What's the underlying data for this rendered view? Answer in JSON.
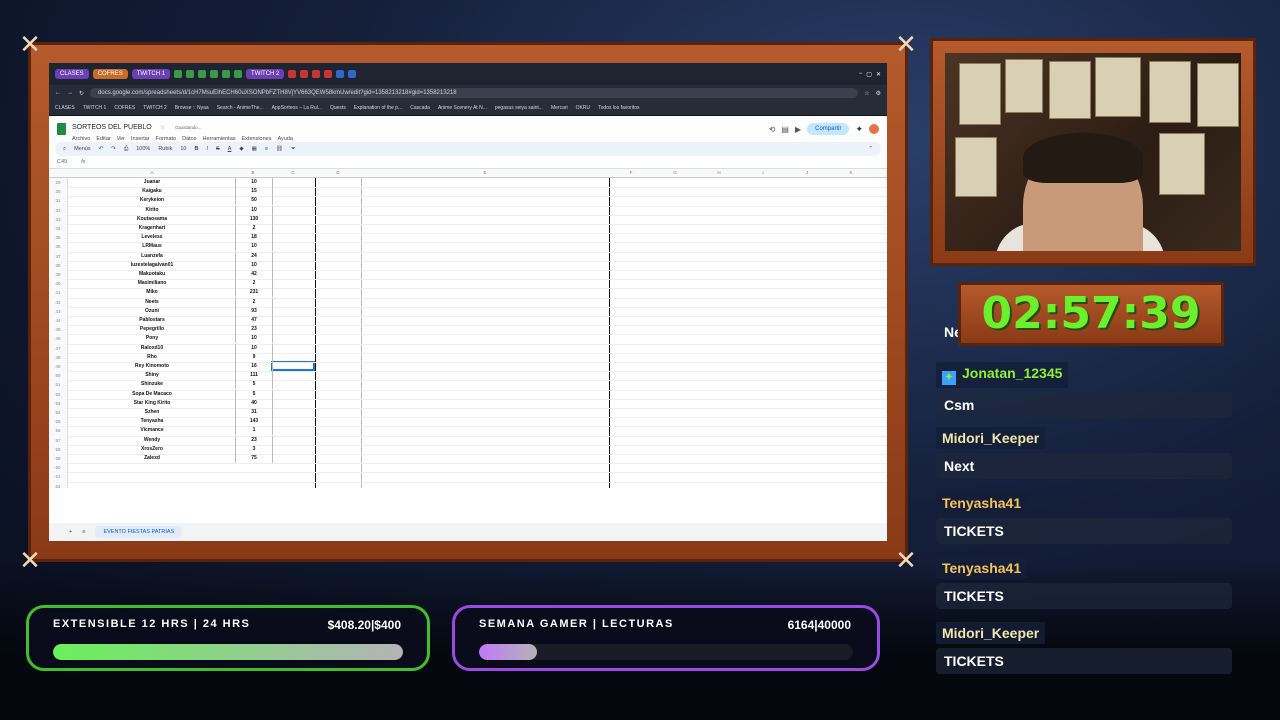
{
  "browser": {
    "tabs": [
      "CLASES",
      "COFRES",
      "TWITCH 1",
      "TWITCH 2"
    ],
    "url": "docs.google.com/spreadsheets/d/1cH7MsuEIhECH60uXSONPbFZTH8VjYV663QEW58kmUw/edit?gid=1358213218#gid=1358213218",
    "bookmarks": [
      "CLASES",
      "TWITCH 1",
      "COFRES",
      "TWITCH 2",
      "Browse :: Nyaa",
      "Search - AnimeThe...",
      "AppSorteos – La Rul...",
      "Quests",
      "Explanation of the p...",
      "Cascada",
      "Anime Scenery At N...",
      "pegasus seiya saint...",
      "Mercari",
      "OKRU",
      "Todos los favoritos"
    ]
  },
  "sheet": {
    "title": "SORTEOS DEL PUEBLO",
    "saving": "Guardando...",
    "menus": [
      "Archivo",
      "Editar",
      "Ver",
      "Insertar",
      "Formato",
      "Datos",
      "Herramientas",
      "Extensiones",
      "Ayuda"
    ],
    "share_label": "Compartir",
    "toolbar": {
      "menus": "Menús",
      "zoom": "100%",
      "font": "Rubik",
      "size": "10"
    },
    "cell_ref": "C49",
    "columns": [
      "A",
      "B",
      "C",
      "D",
      "E",
      "F",
      "G",
      "H",
      "I",
      "J",
      "K"
    ],
    "rows": [
      {
        "n": "29",
        "name": "Juanar",
        "val": "10"
      },
      {
        "n": "30",
        "name": "Kaigaku",
        "val": "15"
      },
      {
        "n": "31",
        "name": "Kerykeion",
        "val": "50"
      },
      {
        "n": "32",
        "name": "Kirito",
        "val": "10"
      },
      {
        "n": "33",
        "name": "Koutaosama",
        "val": "130"
      },
      {
        "n": "34",
        "name": "Kragenhart",
        "val": "2"
      },
      {
        "n": "35",
        "name": "Leveless",
        "val": "18"
      },
      {
        "n": "36",
        "name": "LRMaus",
        "val": "10"
      },
      {
        "n": "37",
        "name": "Luanzefa",
        "val": "24"
      },
      {
        "n": "38",
        "name": "luzestelagalvan01",
        "val": "10"
      },
      {
        "n": "39",
        "name": "Makuotaku",
        "val": "42"
      },
      {
        "n": "40",
        "name": "Maximiliano",
        "val": "2"
      },
      {
        "n": "41",
        "name": "Miko",
        "val": "231"
      },
      {
        "n": "42",
        "name": "Neets",
        "val": "2"
      },
      {
        "n": "43",
        "name": "Ozuni",
        "val": "93"
      },
      {
        "n": "44",
        "name": "Pablostars",
        "val": "47"
      },
      {
        "n": "45",
        "name": "Pepegrillo",
        "val": "23"
      },
      {
        "n": "46",
        "name": "Pony",
        "val": "10"
      },
      {
        "n": "47",
        "name": "Raloxd10",
        "val": "10"
      },
      {
        "n": "48",
        "name": "Rho",
        "val": "9"
      },
      {
        "n": "49",
        "name": "Rey Kinomoto",
        "val": "16"
      },
      {
        "n": "50",
        "name": "Shiny",
        "val": "111"
      },
      {
        "n": "51",
        "name": "Shinzuke",
        "val": "5"
      },
      {
        "n": "52",
        "name": "Sopa De Macaco",
        "val": "5"
      },
      {
        "n": "53",
        "name": "Star King Kirito",
        "val": "40"
      },
      {
        "n": "54",
        "name": "Szhen",
        "val": "31"
      },
      {
        "n": "55",
        "name": "Tenyasha",
        "val": "143"
      },
      {
        "n": "56",
        "name": "Vicmance",
        "val": "1"
      },
      {
        "n": "57",
        "name": "Wendy",
        "val": "23"
      },
      {
        "n": "58",
        "name": "XrosZero",
        "val": "3"
      },
      {
        "n": "59",
        "name": "Zalexd",
        "val": "75"
      },
      {
        "n": "60",
        "name": "",
        "val": ""
      },
      {
        "n": "61",
        "name": "",
        "val": ""
      },
      {
        "n": "62",
        "name": "",
        "val": ""
      }
    ],
    "sheet_tab": "EVENTO FIESTAS PATRIAS"
  },
  "timer": {
    "value": "02:57:39",
    "partial_label": "Ne"
  },
  "chat": [
    {
      "user": "Jonatan_12345",
      "msg": "Csm",
      "color": "#8ff03a",
      "badge": true
    },
    {
      "user": "Midori_Keeper",
      "msg": "Next",
      "color": "#f1e6a8",
      "badge": false
    },
    {
      "user": "Tenyasha41",
      "msg": "TICKETS",
      "color": "#f6c35a",
      "badge": false
    },
    {
      "user": "Tenyasha41",
      "msg": "TICKETS",
      "color": "#f6c35a",
      "badge": false
    },
    {
      "user": "Midori_Keeper",
      "msg": "TICKETS",
      "color": "#f1e6a8",
      "badge": false
    }
  ],
  "goals": [
    {
      "label": "EXTENSIBLE 12 HRS | 24 HRS",
      "amount": "$408.20|$400",
      "progress": 1.0,
      "color": "#69f05a",
      "border": "#3fbf2a"
    },
    {
      "label": "SEMANA GAMER | LECTURAS",
      "amount": "6164|40000",
      "progress": 0.154,
      "color": "#c07af5",
      "border": "#9a4ae0"
    }
  ]
}
